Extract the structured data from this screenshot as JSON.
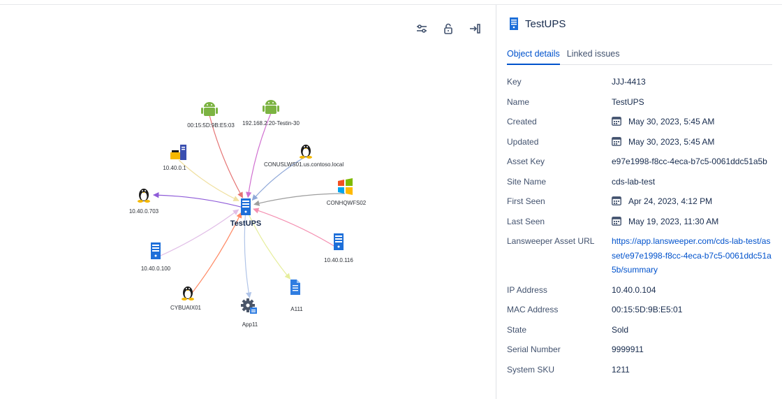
{
  "toolbar": {
    "icons": [
      "sliders-icon",
      "unlock-icon",
      "collapse-panel-icon"
    ]
  },
  "graph": {
    "center": {
      "label": "TestUPS",
      "icon": "server-icon"
    },
    "nodes": [
      {
        "label": "00:15:5D:9B:E5:03",
        "icon": "android-icon"
      },
      {
        "label": "192.168.2.20-Testin-30",
        "icon": "android-icon"
      },
      {
        "label": "CONUSLWS01.us.contoso.local",
        "icon": "linux-icon"
      },
      {
        "label": "CONHQWFS02",
        "icon": "windows-icon"
      },
      {
        "label": "10.40.0.116",
        "icon": "server-icon"
      },
      {
        "label": "A111",
        "icon": "document-icon"
      },
      {
        "label": "App11",
        "icon": "app-gear-icon"
      },
      {
        "label": "CYBUAIX01",
        "icon": "linux-icon"
      },
      {
        "label": "10.40.0.100",
        "icon": "server-icon"
      },
      {
        "label": "10.40.0.703",
        "icon": "linux-icon"
      },
      {
        "label": "10.40.0.1",
        "icon": "network-icon"
      }
    ],
    "colors": {
      "android": "#7cb342",
      "server": "#1e6fd9",
      "edge_palette": [
        "#e57373",
        "#d06fd0",
        "#8fa8d8",
        "#9e9e9e",
        "#f48fb1",
        "#e6ee9c",
        "#b0c4e8",
        "#ff8a65",
        "#e1bee7",
        "#8e5bd8",
        "#f0e0a0"
      ]
    }
  },
  "details": {
    "title": "TestUPS",
    "tabs": [
      {
        "label": "Object details",
        "active": true
      },
      {
        "label": "Linked issues",
        "active": false
      }
    ],
    "rows": [
      {
        "label": "Key",
        "value": "JJJ-4413"
      },
      {
        "label": "Name",
        "value": "TestUPS"
      },
      {
        "label": "Created",
        "value": "May 30, 2023, 5:45 AM",
        "icon": "calendar-icon"
      },
      {
        "label": "Updated",
        "value": "May 30, 2023, 5:45 AM",
        "icon": "calendar-icon"
      },
      {
        "label": "Asset Key",
        "value": "e97e1998-f8cc-4eca-b7c5-0061ddc51a5b"
      },
      {
        "label": "Site Name",
        "value": "cds-lab-test"
      },
      {
        "label": "First Seen",
        "value": "Apr 24, 2023, 4:12 PM",
        "icon": "calendar-icon"
      },
      {
        "label": "Last Seen",
        "value": "May 19, 2023, 11:30 AM",
        "icon": "calendar-icon"
      },
      {
        "label": "Lansweeper Asset URL",
        "value": "https://app.lansweeper.com/cds-lab-test/asset/e97e1998-f8cc-4eca-b7c5-0061ddc51a5b/summary",
        "link": true
      },
      {
        "label": "IP Address",
        "value": "10.40.0.104"
      },
      {
        "label": "MAC Address",
        "value": "00:15:5D:9B:E5:01"
      },
      {
        "label": "State",
        "value": "Sold"
      },
      {
        "label": "Serial Number",
        "value": "9999911"
      },
      {
        "label": "System SKU",
        "value": "1211"
      }
    ]
  }
}
